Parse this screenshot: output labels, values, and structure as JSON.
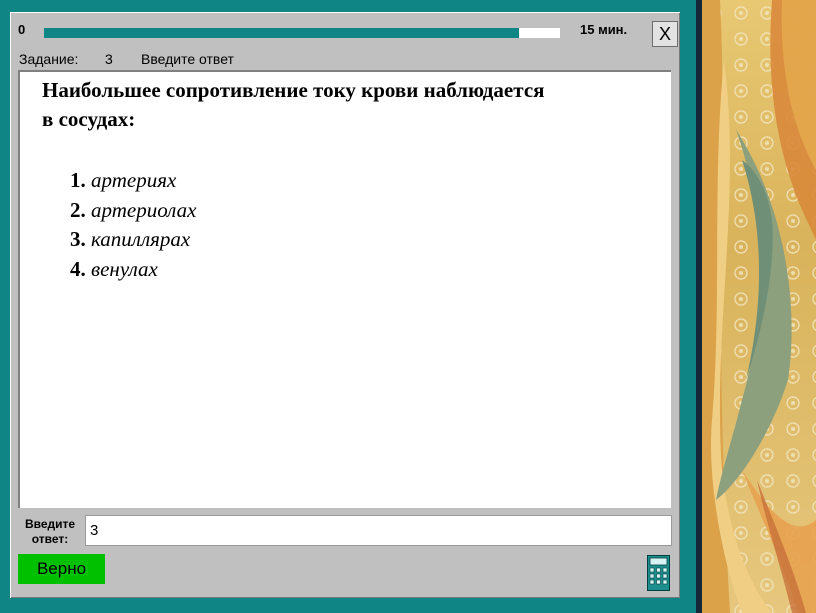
{
  "progress": {
    "start_label": "0",
    "fraction": 0.92,
    "time_limit": "15 мин."
  },
  "window": {
    "close_label": "X"
  },
  "task": {
    "label": "Задание:",
    "number": "3",
    "instruction": "Введите ответ"
  },
  "question": {
    "lines": [
      "Наибольшее сопротивление току крови наблюдается",
      "в сосудах:"
    ],
    "options": [
      {
        "number": "1.",
        "text": "артериях"
      },
      {
        "number": "2.",
        "text": "артериолах"
      },
      {
        "number": "3.",
        "text": "капиллярах"
      },
      {
        "number": "4.",
        "text": "венулах"
      }
    ]
  },
  "answer": {
    "label_line1": "Введите",
    "label_line2": "ответ:",
    "value": "3"
  },
  "result": {
    "label": "Верно",
    "color": "#00c000"
  },
  "colors": {
    "accent": "#0f8585",
    "panel": "#c0c0c0"
  },
  "icons": {
    "calculator": "calculator-icon",
    "close": "close-icon"
  }
}
